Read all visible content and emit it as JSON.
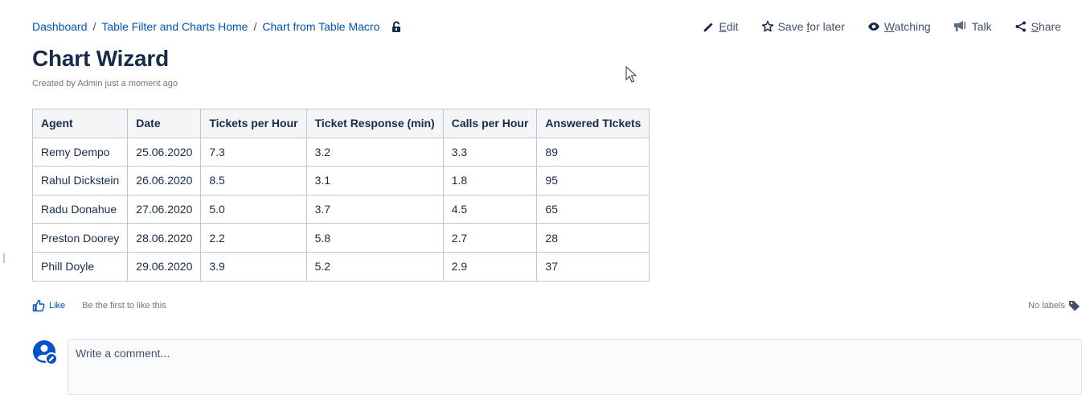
{
  "breadcrumb": {
    "items": [
      "Dashboard",
      "Table Filter and Charts Home",
      "Chart from Table Macro"
    ],
    "separator": "/"
  },
  "actions": {
    "edit": {
      "pre": "",
      "u": "E",
      "post": "dit"
    },
    "save_for_later": {
      "pre": "Save ",
      "u": "f",
      "post": "or later"
    },
    "watching": {
      "pre": "",
      "u": "W",
      "post": "atching"
    },
    "talk": {
      "label": "Talk"
    },
    "share": {
      "pre": "",
      "u": "S",
      "post": "hare"
    }
  },
  "page": {
    "title": "Chart Wizard",
    "byline": "Created by Admin just a moment ago"
  },
  "table": {
    "headers": [
      "Agent",
      "Date",
      "Tickets per Hour",
      "Ticket Response (min)",
      "Calls per Hour",
      "Answered TIckets"
    ],
    "rows": [
      [
        "Remy Dempo",
        "25.06.2020",
        "7.3",
        "3.2",
        "3.3",
        "89"
      ],
      [
        "Rahul Dickstein",
        "26.06.2020",
        "8.5",
        "3.1",
        "1.8",
        "95"
      ],
      [
        "Radu Donahue",
        "27.06.2020",
        "5.0",
        "3.7",
        "4.5",
        "65"
      ],
      [
        "Preston Doorey",
        "28.06.2020",
        "2.2",
        "5.8",
        "2.7",
        "28"
      ],
      [
        "Phill Doyle",
        "29.06.2020",
        "3.9",
        "5.2",
        "2.9",
        "37"
      ]
    ]
  },
  "footer": {
    "like": "Like",
    "first_like": "Be the first to like this",
    "labels": "No labels"
  },
  "comment": {
    "placeholder": "Write a comment..."
  },
  "colors": {
    "link": "#0052cc",
    "text": "#172b4d",
    "subtle": "#6b778c",
    "header_bg": "#f4f5f7",
    "border": "#c1c7d0"
  }
}
